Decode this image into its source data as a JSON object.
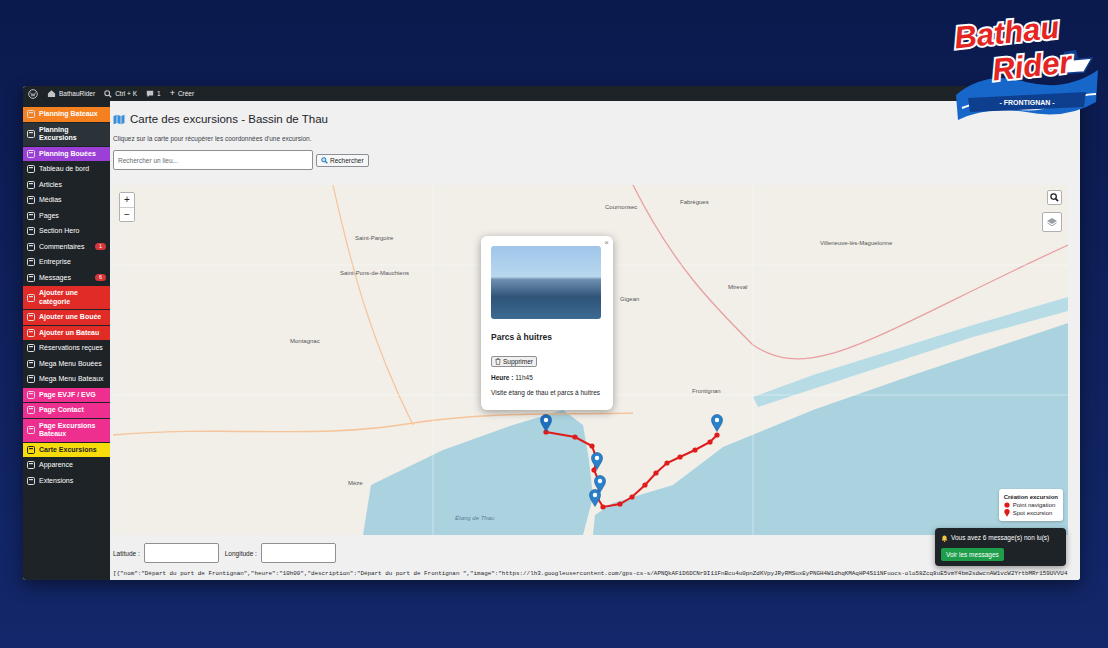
{
  "admin_bar": {
    "site": "BathauRider",
    "search_shortcut": "Ctrl + K",
    "comments": "1",
    "new_icon": "+",
    "new_label": "Créer"
  },
  "sidebar": {
    "items": [
      {
        "label": "Planning Bateaux",
        "color": "#f4801f",
        "badge": "",
        "selected": false
      },
      {
        "label": "Planning Excursions",
        "color": "#2c3338",
        "badge": "",
        "selected": false
      },
      {
        "label": "Planning Bouées",
        "color": "#9b3fd6",
        "badge": "",
        "selected": false
      },
      {
        "label": "Tableau de bord",
        "color": "#1d2327",
        "badge": "",
        "selected": false
      },
      {
        "label": "Articles",
        "color": "#1d2327",
        "badge": "",
        "selected": false
      },
      {
        "label": "Médias",
        "color": "#1d2327",
        "badge": "",
        "selected": false
      },
      {
        "label": "Pages",
        "color": "#1d2327",
        "badge": "",
        "selected": false
      },
      {
        "label": "Section Hero",
        "color": "#1d2327",
        "badge": "",
        "selected": false
      },
      {
        "label": "Commentaires",
        "color": "#1d2327",
        "badge": "1",
        "selected": false
      },
      {
        "label": "Entreprise",
        "color": "#1d2327",
        "badge": "",
        "selected": false
      },
      {
        "label": "Messages",
        "color": "#1d2327",
        "badge": "6",
        "selected": false
      },
      {
        "label": "Ajouter une catégorie",
        "color": "#e02b27",
        "badge": "",
        "selected": false
      },
      {
        "label": "Ajouter une Bouée",
        "color": "#e02b27",
        "badge": "",
        "selected": false
      },
      {
        "label": "Ajouter un Bateau",
        "color": "#e02b27",
        "badge": "",
        "selected": false
      },
      {
        "label": "Réservations reçues",
        "color": "#1d2327",
        "badge": "",
        "selected": false
      },
      {
        "label": "Mega Menu Bouées",
        "color": "#1d2327",
        "badge": "",
        "selected": false
      },
      {
        "label": "Mega Menu Bateaux",
        "color": "#1d2327",
        "badge": "",
        "selected": false
      },
      {
        "label": "Page EVJF / EVG",
        "color": "#ef2f8f",
        "badge": "",
        "selected": false
      },
      {
        "label": "Page Contact",
        "color": "#ef2f8f",
        "badge": "",
        "selected": false
      },
      {
        "label": "Page Excursions Bateaux",
        "color": "#ef2f8f",
        "badge": "",
        "selected": false
      },
      {
        "label": "Carte Excursions",
        "color": "#f7dc0b",
        "badge": "",
        "selected": true
      },
      {
        "label": "Apparence",
        "color": "#1d2327",
        "badge": "",
        "selected": false
      },
      {
        "label": "Extensions",
        "color": "#1d2327",
        "badge": "",
        "selected": false
      }
    ]
  },
  "page": {
    "title": "Carte des excursions - Bassin de Thau",
    "hint": "Cliquez sur la carte pour récupérer les coordonnées d'une excursion.",
    "search": {
      "placeholder": "Rechercher un lieu...",
      "button": "Rechercher"
    }
  },
  "map": {
    "zoom_in": "+",
    "zoom_out": "−",
    "labels": [
      "Fabrègues",
      "Cournonsec",
      "Villeneuve-lès-Maguelonne",
      "Mireval",
      "Gigean",
      "Frontignan",
      "Mèze",
      "Montagnac",
      "Étang de Thau",
      "Saint-Pons-de-Mauchiens",
      "Saint-Pargoire"
    ],
    "spots": [
      {
        "selected": true
      },
      {
        "selected": false
      },
      {
        "selected": false
      },
      {
        "selected": false
      },
      {
        "selected": false
      }
    ],
    "popup": {
      "close": "×",
      "title": "Parcs à huitres",
      "delete": "Supprimer",
      "time_label": "Heure :",
      "time": "11h45",
      "description": "Visite étang de thau et parcs à huitres"
    },
    "legend": {
      "title": "Création excursion",
      "items": [
        {
          "label": "Point navigation",
          "kind": "dot",
          "color": "#e01b1b"
        },
        {
          "label": "Spot excursion",
          "kind": "pin",
          "color": "#e01b1b"
        }
      ]
    }
  },
  "coordinates": {
    "latitude_label": "Latitude :",
    "latitude": "",
    "longitude_label": "Longitude :",
    "longitude": ""
  },
  "json_output": "[{\"nom\":\"Départ du port de Frontignan\",\"heure\":\"10h00\",\"description\":\"Départ du port de Frontignan \",\"image\":\"https://lh3.googleusercontent.com/gps-cs-s/APNQkAF1D6DCNr9I11FnBcu4u0pnZdKVpyJRyRMSuxEyPNGH4W1dhqKMAqHP4S11NFuocs-olo58Zcq8uE5vmY4bm2sdwcnAW1vcW2YrtbMRr159UVVU4",
  "notification": {
    "message": "Vous avez 6 message(s) non lu(s)",
    "button": "Voir les messages"
  },
  "logo": {
    "line1": "Bathau",
    "line2": "Rider",
    "ribbon": "- FRONTIGNAN -"
  }
}
